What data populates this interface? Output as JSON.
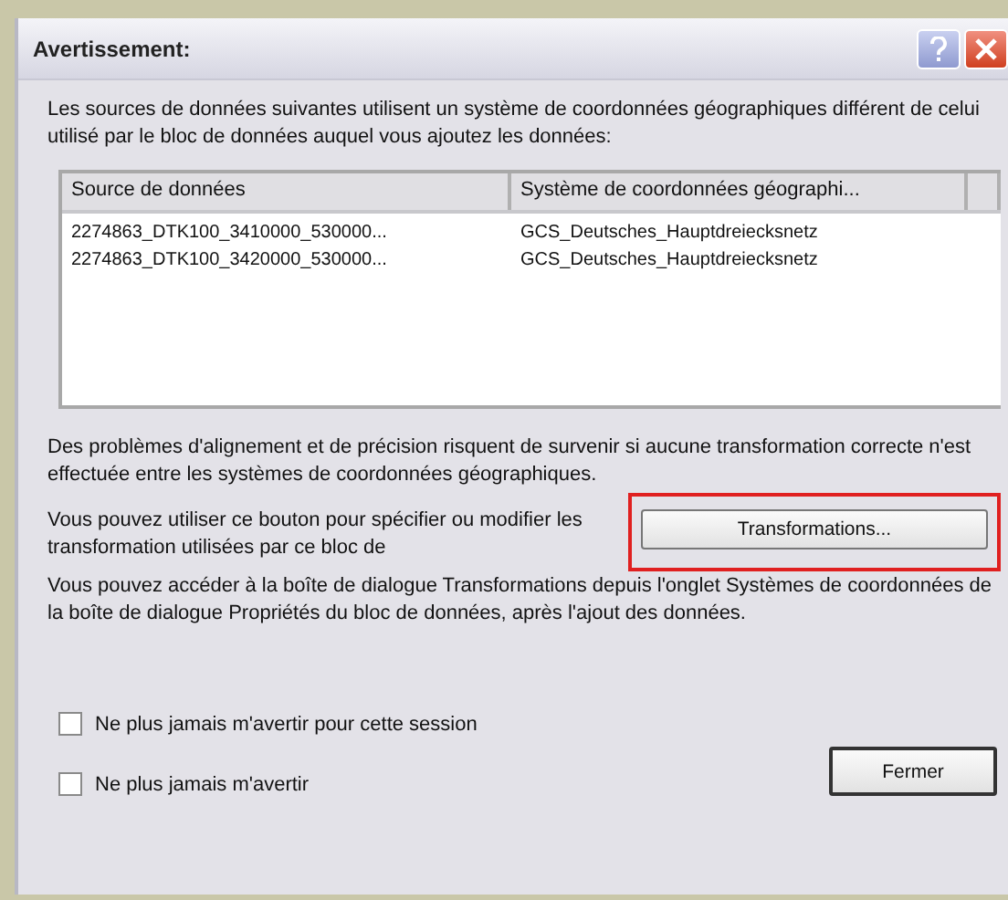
{
  "window": {
    "title": "Avertissement:"
  },
  "intro": "Les sources de données suivantes utilisent un système de coordonnées géographiques différent de celui utilisé par le bloc de données auquel vous ajoutez les données:",
  "table": {
    "columns": [
      "Source de données",
      "Système de coordonnées géographi..."
    ],
    "rows": [
      [
        "2274863_DTK100_3410000_530000...",
        "GCS_Deutsches_Hauptdreiecksnetz"
      ],
      [
        "2274863_DTK100_3420000_530000...",
        "GCS_Deutsches_Hauptdreiecksnetz"
      ]
    ]
  },
  "warning": "Des problèmes d'alignement et de précision risquent de survenir si aucune transformation correcte n'est effectuée entre les systèmes de coordonnées géographiques.",
  "button_hint": "Vous pouvez utiliser ce bouton pour spécifier ou modifier les transformation utilisées par ce bloc de",
  "transformations_button": {
    "label": "Transformations...",
    "highlighted": true
  },
  "info": "Vous pouvez accéder à la boîte de dialogue Transformations depuis l'onglet Systèmes de coordonnées de la boîte de dialogue Propriétés du bloc de données, après l'ajout des données.",
  "checkboxes": [
    {
      "label": "Ne plus jamais m'avertir pour cette session",
      "checked": false
    },
    {
      "label": "Ne plus jamais m'avertir",
      "checked": false
    }
  ],
  "close_button": "Fermer"
}
